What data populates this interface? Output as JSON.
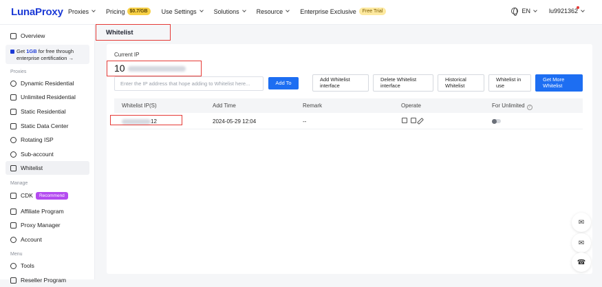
{
  "header": {
    "logo": "LunaProxy",
    "nav": [
      {
        "label": "Proxies",
        "has_dropdown": true
      },
      {
        "label": "Pricing",
        "badge": "$0.7/GB"
      },
      {
        "label": "Use Settings",
        "has_dropdown": true
      },
      {
        "label": "Solutions",
        "has_dropdown": true
      },
      {
        "label": "Resource",
        "has_dropdown": true
      },
      {
        "label": "Enterprise Exclusive",
        "badge": "Free Trial"
      }
    ],
    "language": "EN",
    "username": "lu9921362"
  },
  "sidebar": {
    "overview": "Overview",
    "promo_prefix": "Get",
    "promo_highlight": "1GB",
    "promo_suffix": "for free through",
    "promo_line2": "enterprise certification →",
    "section_proxies": "Proxies",
    "proxies": [
      "Dynamic Residential",
      "Unlimited Residential",
      "Static Residential",
      "Static Data Center",
      "Rotating ISP",
      "Sub-account",
      "Whitelist"
    ],
    "section_manage": "Manage",
    "manage": [
      "CDK",
      "Affiliate Program",
      "Proxy Manager",
      "Account"
    ],
    "cdk_badge": "Recommend",
    "section_menu": "Menu",
    "menu": [
      "Tools",
      "Reseller Program"
    ]
  },
  "page": {
    "breadcrumb": "Whitelist",
    "current_ip_label": "Current IP",
    "current_ip_visible": "10",
    "input_placeholder": "Enter the IP address that hope adding to Whitelist here...",
    "add_button": "Add To",
    "buttons": [
      "Add Whitelist interface",
      "Delete Whitelist interface",
      "Historical Whitelist",
      "Whitelist in use",
      "Get More Whitelist"
    ]
  },
  "table": {
    "columns": [
      "Whitelist IP(S)",
      "Add Time",
      "Remark",
      "Operate",
      "For Unlimited"
    ],
    "rows": [
      {
        "ip_visible": "12",
        "add_time": "2024-05-29 12:04",
        "remark": "--",
        "for_unlimited": false
      }
    ]
  },
  "floating_buttons": [
    "bell-icon",
    "mail-icon",
    "headset-icon"
  ]
}
